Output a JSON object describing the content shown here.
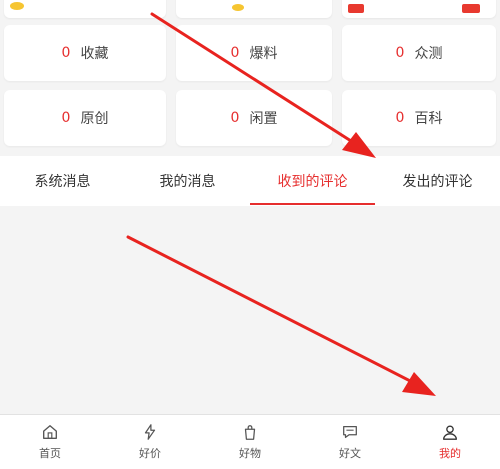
{
  "stats": [
    {
      "value": "0",
      "label": "收藏"
    },
    {
      "value": "0",
      "label": "爆料"
    },
    {
      "value": "0",
      "label": "众测"
    },
    {
      "value": "0",
      "label": "原创"
    },
    {
      "value": "0",
      "label": "闲置"
    },
    {
      "value": "0",
      "label": "百科"
    }
  ],
  "tabs": [
    {
      "label": "系统消息",
      "active": false
    },
    {
      "label": "我的消息",
      "active": false
    },
    {
      "label": "收到的评论",
      "active": true
    },
    {
      "label": "发出的评论",
      "active": false
    }
  ],
  "nav": [
    {
      "label": "首页",
      "icon": "home-icon"
    },
    {
      "label": "好价",
      "icon": "lightning-icon"
    },
    {
      "label": "好物",
      "icon": "bag-icon"
    },
    {
      "label": "好文",
      "icon": "chat-icon"
    },
    {
      "label": "我的",
      "icon": "user-icon",
      "active": true
    }
  ],
  "colors": {
    "accent": "#e62e2e",
    "arrow": "#e8231f"
  }
}
